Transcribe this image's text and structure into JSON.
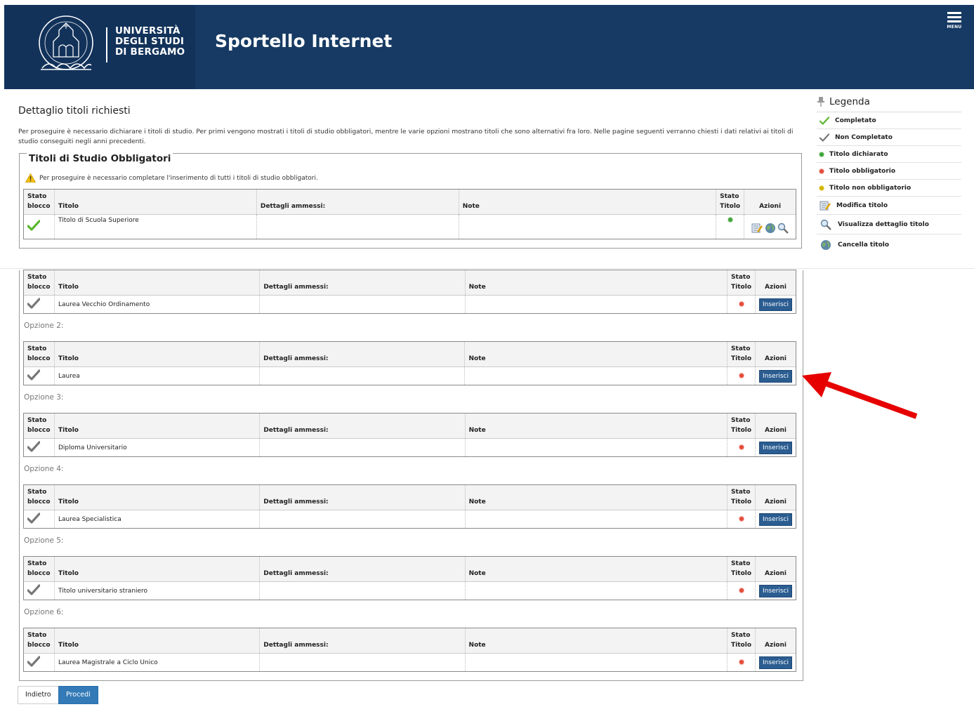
{
  "header": {
    "logo_lines": [
      "UNIVERSITÀ",
      "DEGLI STUDI",
      "DI BERGAMO"
    ],
    "app_title": "Sportello Internet",
    "menu_label": "MENU"
  },
  "page": {
    "title": "Dettaglio titoli richiesti",
    "intro": "Per proseguire è necessario dichiarare i titoli di studio. Per primi vengono mostrati i titoli di studio obbligatori, mentre le varie opzioni mostrano titoli che sono alternativi fra loro. Nelle pagine seguenti verranno chiesti i dati relativi ai titoli di studio conseguiti negli anni precedenti.",
    "section_title": "Titoli di Studio Obbligatori",
    "warning": "Per proseguire è necessario completare l'inserimento di tutti i titoli di studio obbligatori."
  },
  "table_headers": {
    "stato_blocco_1": "Stato",
    "stato_blocco_2": "blocco",
    "titolo": "Titolo",
    "dettagli": "Dettagli ammessi:",
    "note": "Note",
    "stato_titolo_1": "Stato",
    "stato_titolo_2": "Titolo",
    "azioni": "Azioni"
  },
  "obbligatori": {
    "titolo": "Titolo di Scuola Superiore",
    "status": "completato",
    "dot": "green"
  },
  "opzioni": [
    {
      "label": "",
      "titolo": "Laurea Vecchio Ordinamento",
      "button": "Inserisci"
    },
    {
      "label": "Opzione 2:",
      "titolo": "Laurea",
      "button": "Inserisci"
    },
    {
      "label": "Opzione 3:",
      "titolo": "Diploma Universitario",
      "button": "Inserisci"
    },
    {
      "label": "Opzione 4:",
      "titolo": "Laurea Specialistica",
      "button": "Inserisci"
    },
    {
      "label": "Opzione 5:",
      "titolo": "Titolo universitario straniero",
      "button": "Inserisci"
    },
    {
      "label": "Opzione 6:",
      "titolo": "Laurea Magistrale a Ciclo Unico",
      "button": "Inserisci"
    }
  ],
  "legenda": {
    "title": "Legenda",
    "items": [
      {
        "label": "Completato",
        "icon": "check-green-icon"
      },
      {
        "label": "Non Completato",
        "icon": "check-gray-icon"
      },
      {
        "label": "Titolo dichiarato",
        "icon": "dot-green-icon"
      },
      {
        "label": "Titolo obbligatorio",
        "icon": "dot-red-icon"
      },
      {
        "label": "Titolo non obbligatorio",
        "icon": "dot-yellow-icon"
      },
      {
        "label": "Modifica titolo",
        "icon": "edit-icon"
      },
      {
        "label": "Visualizza dettaglio titolo",
        "icon": "magnifier-icon"
      },
      {
        "label": "Cancella titolo",
        "icon": "globe-delete-icon"
      }
    ]
  },
  "buttons": {
    "back": "Indietro",
    "next": "Procedi"
  },
  "colors": {
    "header_bg": "#163a63",
    "primary_button": "#337ab7",
    "inserisci_button": "#2b5d91",
    "annotation_arrow": "#e60000"
  }
}
